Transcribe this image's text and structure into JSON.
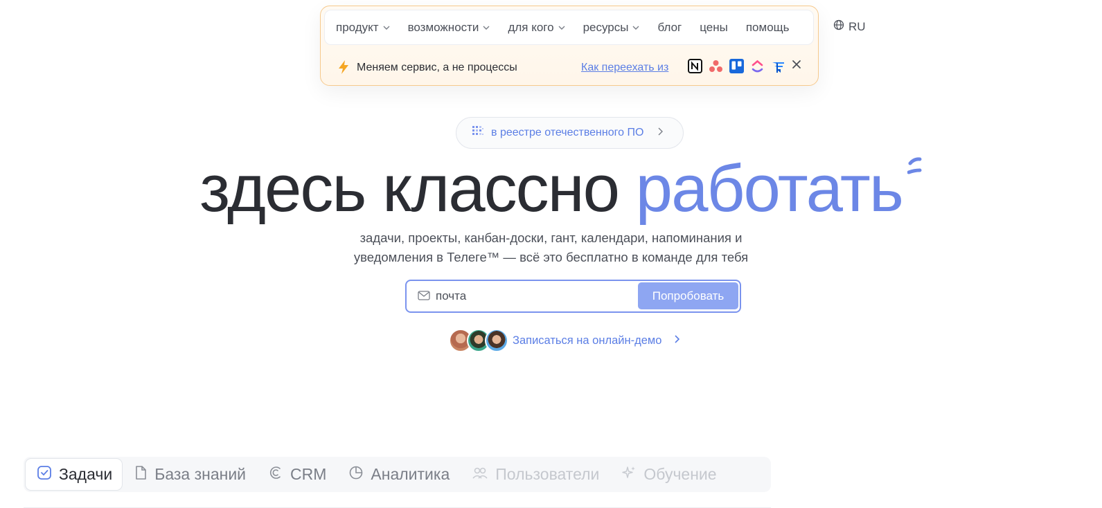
{
  "nav": {
    "items": [
      {
        "label": "продукт",
        "dropdown": true
      },
      {
        "label": "возможности",
        "dropdown": true
      },
      {
        "label": "для кого",
        "dropdown": true
      },
      {
        "label": "ресурсы",
        "dropdown": true
      },
      {
        "label": "блог",
        "dropdown": false
      },
      {
        "label": "цены",
        "dropdown": false
      },
      {
        "label": "помощь",
        "dropdown": false
      }
    ],
    "language": "RU"
  },
  "announcement": {
    "text": "Меняем сервис, а не процессы",
    "link": "Как переехать из",
    "services": [
      "notion-icon",
      "asana-icon",
      "trello-icon",
      "clickup-icon",
      "jira-icon"
    ]
  },
  "registry": {
    "label": "в реестре отечественного ПО"
  },
  "hero": {
    "title_main": "здесь классно ",
    "title_accent": "работать",
    "subtitle_line1": "задачи, проекты, канбан-доски, гант, календари, напоминания и",
    "subtitle_line2": "уведомления в Телеге™ — всё это бесплатно в команде для тебя"
  },
  "signup": {
    "email_placeholder": "почта",
    "button": "Попробовать"
  },
  "demo": {
    "link": "Записаться на онлайн-демо"
  },
  "tabs": [
    {
      "label": "Задачи",
      "icon": "check-square-icon",
      "active": true
    },
    {
      "label": "База знаний",
      "icon": "document-icon",
      "active": false
    },
    {
      "label": "CRM",
      "icon": "crm-icon",
      "active": false
    },
    {
      "label": "Аналитика",
      "icon": "pie-chart-icon",
      "active": false
    },
    {
      "label": "Пользователи",
      "icon": "users-icon",
      "active": false,
      "faded": true
    },
    {
      "label": "Обучение",
      "icon": "sparkle-icon",
      "active": false,
      "faded": true
    }
  ],
  "colors": {
    "accent": "#6c87e6",
    "link": "#5b7ee5",
    "button": "#8ea6f2",
    "banner_border": "#f6c98c",
    "bolt": "#f5a623"
  }
}
